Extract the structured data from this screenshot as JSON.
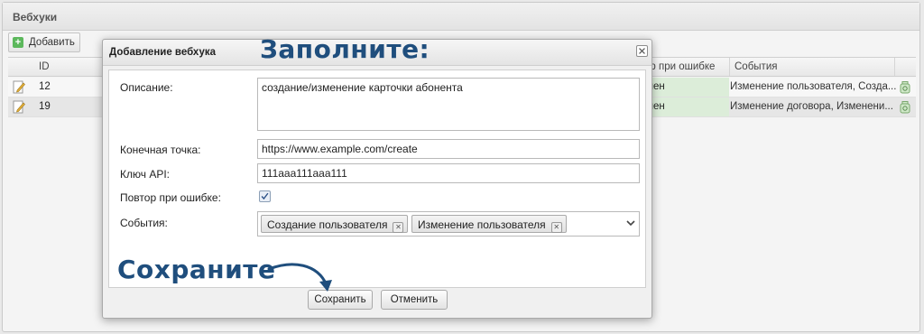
{
  "panel": {
    "title": "Вебхуки",
    "add_label": "Добавить"
  },
  "grid": {
    "columns": {
      "id": "ID",
      "retry": "ор при ошибке",
      "events": "События"
    },
    "rows": [
      {
        "id": "12",
        "retry": "чен",
        "events": "Изменение пользователя, Созда..."
      },
      {
        "id": "19",
        "retry": "чен",
        "events": "Изменение договора, Изменени..."
      }
    ]
  },
  "dialog": {
    "title": "Добавление вебхука",
    "labels": {
      "description": "Описание:",
      "endpoint": "Конечная точка:",
      "api_key": "Ключ API:",
      "retry": "Повтор при ошибке:",
      "events": "События:"
    },
    "values": {
      "description": "создание/изменение карточки абонента",
      "endpoint": "https://www.example.com/create",
      "api_key": "111aaa111aaa111",
      "retry_checked": true
    },
    "event_tags": [
      "Создание пользователя",
      "Изменение пользователя"
    ],
    "save_label": "Сохранить",
    "cancel_label": "Отменить"
  },
  "annotations": {
    "fill": "Заполните:",
    "save": "Сохраните"
  },
  "colors": {
    "annotation": "#1f4e7d",
    "retry_cell": "#dcedd9",
    "add_icon": "#5cb85c"
  }
}
